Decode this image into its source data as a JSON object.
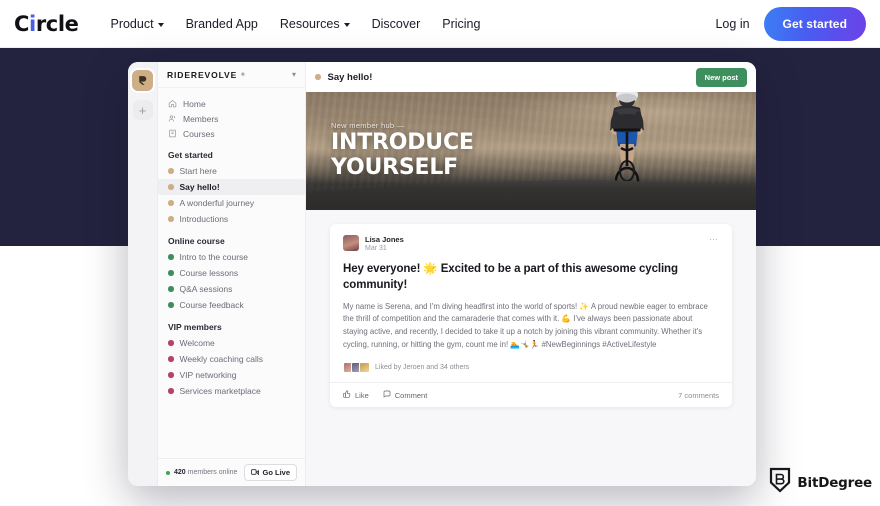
{
  "topnav": {
    "brand": "Circle",
    "links": [
      {
        "label": "Product",
        "has_caret": true
      },
      {
        "label": "Branded App",
        "has_caret": false
      },
      {
        "label": "Resources",
        "has_caret": true
      },
      {
        "label": "Discover",
        "has_caret": false
      },
      {
        "label": "Pricing",
        "has_caret": false
      }
    ],
    "login_label": "Log in",
    "cta_label": "Get started",
    "cta_gradient_from": "#3c7ff5",
    "cta_gradient_to": "#6d42e8"
  },
  "hero_band": {
    "color": "#24233f"
  },
  "app": {
    "rail": {
      "workspace_logo_icon": "riderevolve-r-logo-icon",
      "add_label": "+"
    },
    "sidebar": {
      "workspace_name": "RIDEREVOLVE",
      "workspace_superscript": "®",
      "chevron_icon": "chevron-down-icon",
      "nav": [
        {
          "label": "Home",
          "icon": "home-icon"
        },
        {
          "label": "Members",
          "icon": "members-icon"
        },
        {
          "label": "Courses",
          "icon": "courses-icon"
        }
      ],
      "groups": [
        {
          "title": "Get started",
          "dot_color": "#cdae87",
          "items": [
            {
              "label": "Start here",
              "active": false
            },
            {
              "label": "Say hello!",
              "active": true
            },
            {
              "label": "A wonderful journey",
              "active": false
            },
            {
              "label": "Introductions",
              "active": false
            }
          ]
        },
        {
          "title": "Online course",
          "dot_color": "#3f8f5e",
          "items": [
            {
              "label": "Intro to the course",
              "active": false
            },
            {
              "label": "Course lessons",
              "active": false
            },
            {
              "label": "Q&A sessions",
              "active": false
            },
            {
              "label": "Course feedback",
              "active": false
            }
          ]
        },
        {
          "title": "VIP members",
          "dot_color": "#b2436d",
          "items": [
            {
              "label": "Welcome",
              "active": false
            },
            {
              "label": "Weekly coaching calls",
              "active": false
            },
            {
              "label": "VIP networking",
              "active": false
            },
            {
              "label": "Services marketplace",
              "active": false
            }
          ]
        }
      ],
      "footer": {
        "online_count": "420",
        "online_suffix": " members online",
        "online_dot_color": "#34a853",
        "go_live_label": "Go Live",
        "go_live_icon": "video-camera-icon"
      }
    },
    "main_header": {
      "space_dot_color": "#cdae87",
      "title": "Say hello!",
      "new_post_label": "New post",
      "new_post_color": "#3f8f5e"
    },
    "banner": {
      "kicker": "New member hub —",
      "title_line1": "INTRODUCE",
      "title_line2": "YOURSELF",
      "image_alt": "cyclist-on-desert-road"
    },
    "post": {
      "author": "Lisa Jones",
      "date": "Mar 31",
      "menu_icon": "more-horizontal-icon",
      "avatar_icon": "user-avatar",
      "title": "Hey everyone! 🌟 Excited to be a part of this awesome cycling community!",
      "body": "My name is Serena, and I'm diving headfirst into the world of sports! ✨ A proud newbie eager to embrace the thrill of competition and the camaraderie that comes with it. 💪 I've always been passionate about staying active, and recently, I decided to take it up a notch by joining this vibrant community. Whether it's cycling, running, or hitting the gym, count me in! 🏊🤸🏃 #NewBeginnings #ActiveLifestyle",
      "liked_by": "Liked by Jeroen and 34 others",
      "like_label": "Like",
      "like_icon": "thumbs-up-icon",
      "comment_label": "Comment",
      "comment_icon": "speech-bubble-icon",
      "comments_count": "7 comments"
    }
  },
  "watermark": {
    "name": "BitDegree",
    "shield_icon": "bitdegree-shield-b-icon"
  }
}
